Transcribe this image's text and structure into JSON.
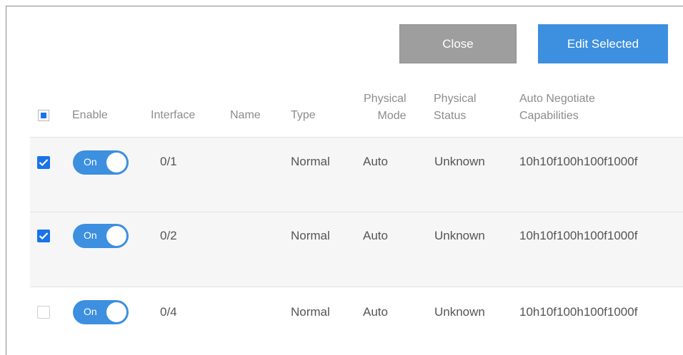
{
  "buttons": {
    "close": "Close",
    "edit_selected": "Edit Selected"
  },
  "header": {
    "enable": "Enable",
    "interface": "Interface",
    "name": "Name",
    "type": "Type",
    "physical_mode": [
      "Physical",
      "Mode"
    ],
    "physical_status": [
      "Physical",
      "Status"
    ],
    "auto_negotiate": [
      "Auto Negotiate",
      "Capabilities"
    ]
  },
  "rows": [
    {
      "checked": true,
      "toggle": "On",
      "interface": "0/1",
      "name": "",
      "type": "Normal",
      "mode": "Auto",
      "status": "Unknown",
      "capabilities": "10h10f100h100f1000f"
    },
    {
      "checked": true,
      "toggle": "On",
      "interface": "0/2",
      "name": "",
      "type": "Normal",
      "mode": "Auto",
      "status": "Unknown",
      "capabilities": "10h10f100h100f1000f"
    },
    {
      "checked": false,
      "toggle": "On",
      "interface": "0/4",
      "name": "",
      "type": "Normal",
      "mode": "Auto",
      "status": "Unknown",
      "capabilities": "10h10f100h100f1000f"
    }
  ],
  "colors": {
    "accent": "#3d8fe0",
    "checkbox": "#1a73e8",
    "close_button": "#9e9e9e"
  }
}
